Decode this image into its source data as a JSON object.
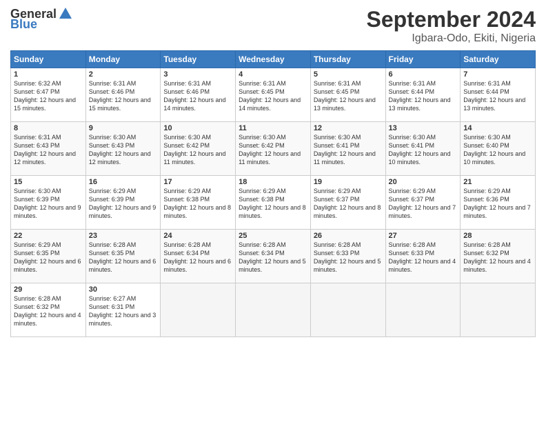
{
  "header": {
    "logo_general": "General",
    "logo_blue": "Blue",
    "month": "September 2024",
    "location": "Igbara-Odo, Ekiti, Nigeria"
  },
  "weekdays": [
    "Sunday",
    "Monday",
    "Tuesday",
    "Wednesday",
    "Thursday",
    "Friday",
    "Saturday"
  ],
  "weeks": [
    [
      {
        "day": "1",
        "sunrise": "6:32 AM",
        "sunset": "6:47 PM",
        "daylight": "12 hours and 15 minutes."
      },
      {
        "day": "2",
        "sunrise": "6:31 AM",
        "sunset": "6:46 PM",
        "daylight": "12 hours and 15 minutes."
      },
      {
        "day": "3",
        "sunrise": "6:31 AM",
        "sunset": "6:46 PM",
        "daylight": "12 hours and 14 minutes."
      },
      {
        "day": "4",
        "sunrise": "6:31 AM",
        "sunset": "6:45 PM",
        "daylight": "12 hours and 14 minutes."
      },
      {
        "day": "5",
        "sunrise": "6:31 AM",
        "sunset": "6:45 PM",
        "daylight": "12 hours and 13 minutes."
      },
      {
        "day": "6",
        "sunrise": "6:31 AM",
        "sunset": "6:44 PM",
        "daylight": "12 hours and 13 minutes."
      },
      {
        "day": "7",
        "sunrise": "6:31 AM",
        "sunset": "6:44 PM",
        "daylight": "12 hours and 13 minutes."
      }
    ],
    [
      {
        "day": "8",
        "sunrise": "6:31 AM",
        "sunset": "6:43 PM",
        "daylight": "12 hours and 12 minutes."
      },
      {
        "day": "9",
        "sunrise": "6:30 AM",
        "sunset": "6:43 PM",
        "daylight": "12 hours and 12 minutes."
      },
      {
        "day": "10",
        "sunrise": "6:30 AM",
        "sunset": "6:42 PM",
        "daylight": "12 hours and 11 minutes."
      },
      {
        "day": "11",
        "sunrise": "6:30 AM",
        "sunset": "6:42 PM",
        "daylight": "12 hours and 11 minutes."
      },
      {
        "day": "12",
        "sunrise": "6:30 AM",
        "sunset": "6:41 PM",
        "daylight": "12 hours and 11 minutes."
      },
      {
        "day": "13",
        "sunrise": "6:30 AM",
        "sunset": "6:41 PM",
        "daylight": "12 hours and 10 minutes."
      },
      {
        "day": "14",
        "sunrise": "6:30 AM",
        "sunset": "6:40 PM",
        "daylight": "12 hours and 10 minutes."
      }
    ],
    [
      {
        "day": "15",
        "sunrise": "6:30 AM",
        "sunset": "6:39 PM",
        "daylight": "12 hours and 9 minutes."
      },
      {
        "day": "16",
        "sunrise": "6:29 AM",
        "sunset": "6:39 PM",
        "daylight": "12 hours and 9 minutes."
      },
      {
        "day": "17",
        "sunrise": "6:29 AM",
        "sunset": "6:38 PM",
        "daylight": "12 hours and 8 minutes."
      },
      {
        "day": "18",
        "sunrise": "6:29 AM",
        "sunset": "6:38 PM",
        "daylight": "12 hours and 8 minutes."
      },
      {
        "day": "19",
        "sunrise": "6:29 AM",
        "sunset": "6:37 PM",
        "daylight": "12 hours and 8 minutes."
      },
      {
        "day": "20",
        "sunrise": "6:29 AM",
        "sunset": "6:37 PM",
        "daylight": "12 hours and 7 minutes."
      },
      {
        "day": "21",
        "sunrise": "6:29 AM",
        "sunset": "6:36 PM",
        "daylight": "12 hours and 7 minutes."
      }
    ],
    [
      {
        "day": "22",
        "sunrise": "6:29 AM",
        "sunset": "6:35 PM",
        "daylight": "12 hours and 6 minutes."
      },
      {
        "day": "23",
        "sunrise": "6:28 AM",
        "sunset": "6:35 PM",
        "daylight": "12 hours and 6 minutes."
      },
      {
        "day": "24",
        "sunrise": "6:28 AM",
        "sunset": "6:34 PM",
        "daylight": "12 hours and 6 minutes."
      },
      {
        "day": "25",
        "sunrise": "6:28 AM",
        "sunset": "6:34 PM",
        "daylight": "12 hours and 5 minutes."
      },
      {
        "day": "26",
        "sunrise": "6:28 AM",
        "sunset": "6:33 PM",
        "daylight": "12 hours and 5 minutes."
      },
      {
        "day": "27",
        "sunrise": "6:28 AM",
        "sunset": "6:33 PM",
        "daylight": "12 hours and 4 minutes."
      },
      {
        "day": "28",
        "sunrise": "6:28 AM",
        "sunset": "6:32 PM",
        "daylight": "12 hours and 4 minutes."
      }
    ],
    [
      {
        "day": "29",
        "sunrise": "6:28 AM",
        "sunset": "6:32 PM",
        "daylight": "12 hours and 4 minutes."
      },
      {
        "day": "30",
        "sunrise": "6:27 AM",
        "sunset": "6:31 PM",
        "daylight": "12 hours and 3 minutes."
      },
      null,
      null,
      null,
      null,
      null
    ]
  ]
}
